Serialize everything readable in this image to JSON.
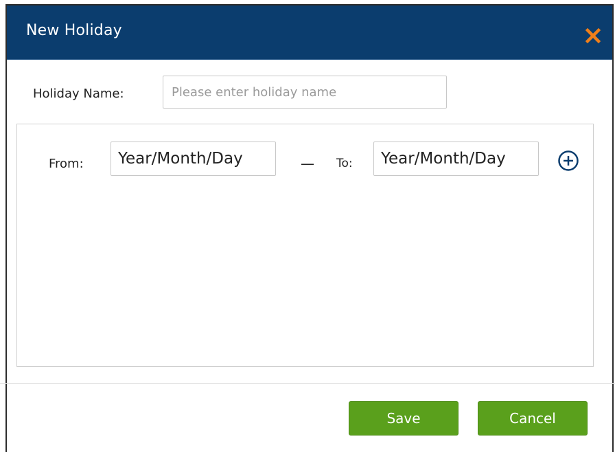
{
  "dialog": {
    "title": "New Holiday",
    "close_icon": "close-icon"
  },
  "form": {
    "holiday_name_label": "Holiday Name:",
    "holiday_name_placeholder": "Please enter holiday name",
    "holiday_name_value": ""
  },
  "date_range": {
    "from_label": "From:",
    "from_placeholder": "Year/Month/Day",
    "separator": "—",
    "to_label": "To:",
    "to_placeholder": "Year/Month/Day",
    "add_icon": "plus-circle-icon"
  },
  "footer": {
    "save_label": "Save",
    "cancel_label": "Cancel"
  },
  "colors": {
    "header_bg": "#0b3d6e",
    "close_icon": "#f07f1a",
    "button_green": "#5aa01c",
    "add_icon": "#0b3d6e"
  }
}
